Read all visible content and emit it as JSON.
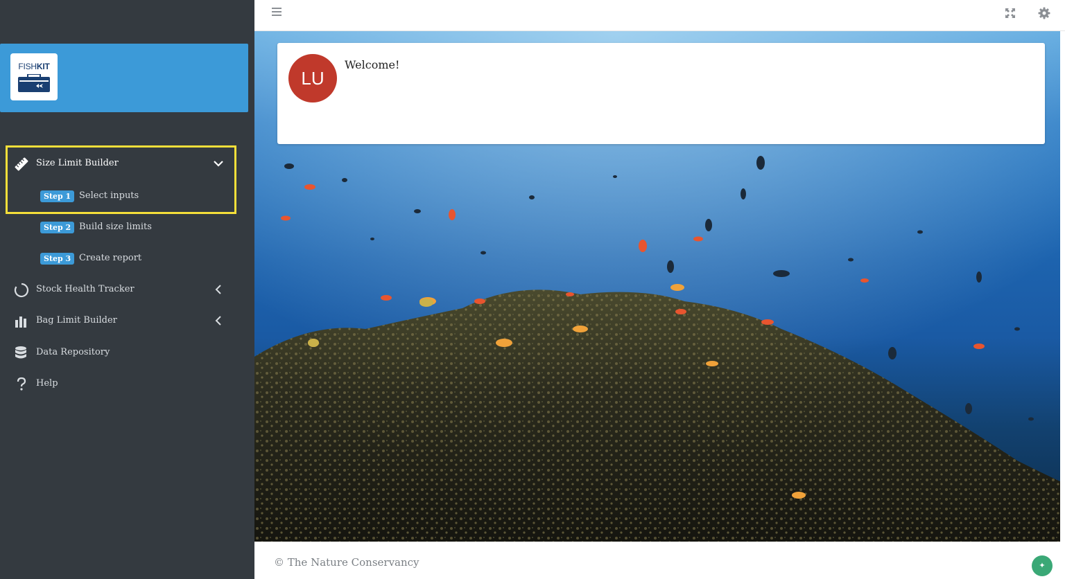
{
  "brand": {
    "logo_word_light": "FISH",
    "logo_word_bold": "KIT",
    "accent_color": "#3c9ad8"
  },
  "sidebar": {
    "items": [
      {
        "label": "Size Limit Builder",
        "icon": "ruler-icon",
        "expanded": true,
        "substeps": [
          {
            "badge": "Step 1",
            "label": "Select inputs"
          },
          {
            "badge": "Step 2",
            "label": "Build size limits"
          },
          {
            "badge": "Step 3",
            "label": "Create report"
          }
        ]
      },
      {
        "label": "Stock Health Tracker",
        "icon": "circle-progress-icon"
      },
      {
        "label": "Bag Limit Builder",
        "icon": "bar-chart-icon"
      },
      {
        "label": "Data Repository",
        "icon": "database-icon"
      },
      {
        "label": "Help",
        "icon": "question-icon"
      }
    ]
  },
  "header": {
    "menu_icon": "hamburger-icon",
    "expand_icon": "expand-icon",
    "settings_icon": "gear-icon"
  },
  "welcome_card": {
    "avatar_initials": "LU",
    "avatar_color": "#c0392b",
    "greeting": "Welcome!"
  },
  "footer": {
    "copyright": "© The Nature Conservancy"
  },
  "highlight_color": "#f5df3a"
}
